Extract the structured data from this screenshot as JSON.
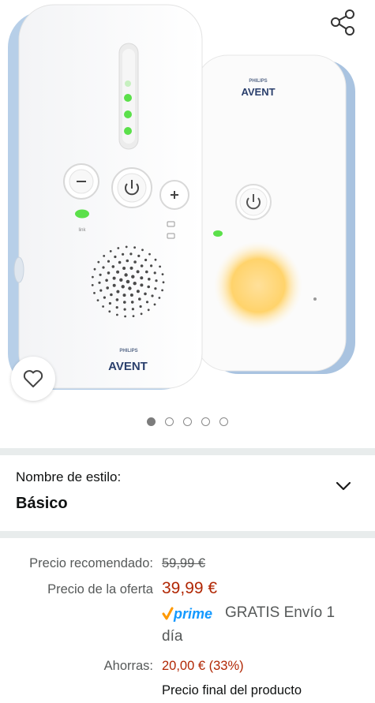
{
  "product_image": {
    "brand_small": "PHILIPS",
    "brand_large": "AVENT",
    "link_label": "link"
  },
  "carousel": {
    "total": 5,
    "active": 0
  },
  "style": {
    "label": "Nombre de estilo:",
    "value": "Básico"
  },
  "price": {
    "rrp_label": "Precio recomendado:",
    "rrp_value": "59,99 €",
    "offer_label": "Precio de la oferta",
    "offer_value": "39,99 €",
    "prime_word": "prime",
    "prime_text_line1": "GRATIS Envío 1",
    "prime_text_line2": "día",
    "savings_label": "Ahorras:",
    "savings_value": "20,00 € (33%)",
    "final_text": "Precio final del producto"
  },
  "colors": {
    "price_red": "#b12704",
    "prime_orange": "#ff9900",
    "prime_blue": "#1399ff",
    "unit_blue": "#b7cfe8",
    "led_green": "#5be04a",
    "night_light": "#ffd36b"
  },
  "icons": {
    "share": "share-icon",
    "wishlist": "heart-icon",
    "chevron": "chevron-down-icon"
  }
}
